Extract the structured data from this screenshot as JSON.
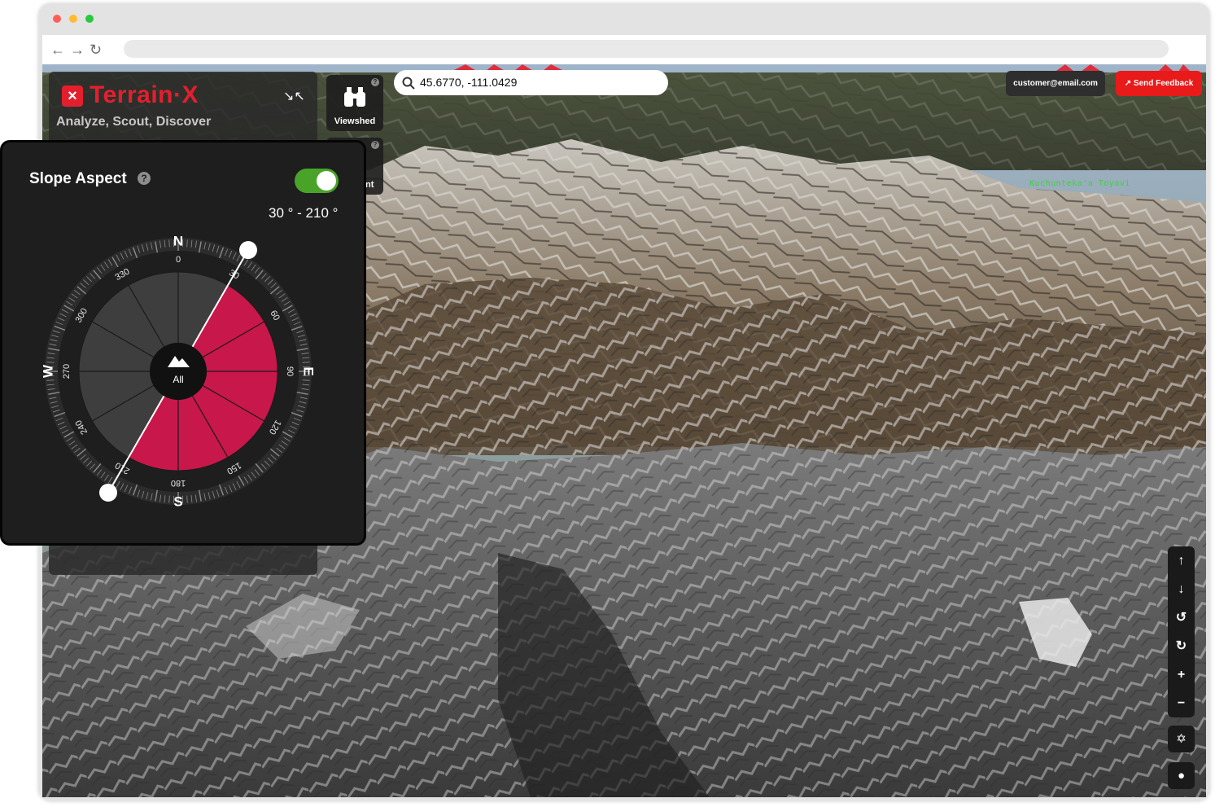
{
  "app": {
    "name": "Terrain·X",
    "tagline": "Analyze, Scout, Discover"
  },
  "browser": {
    "colors": {
      "close": "#ff5f57",
      "minimize": "#febc2e",
      "zoom": "#28c840"
    }
  },
  "tools": {
    "viewshed_label": "Viewshed",
    "second_label_fragment": "nt"
  },
  "search": {
    "value": "45.6770, -111.0429"
  },
  "header": {
    "email": "customer@email.com",
    "feedback_label": "Send Feedback"
  },
  "map": {
    "place_label": "Kuchunteka'a Toyavi"
  },
  "slope_aspect": {
    "title": "Slope Aspect",
    "enabled": true,
    "range_text": "30 ° - 210 °",
    "start_deg": 30,
    "end_deg": 210,
    "center_label": "All",
    "cardinals": {
      "n": "N",
      "e": "E",
      "s": "S",
      "w": "W"
    },
    "degree_labels": [
      "0",
      "30",
      "60",
      "90",
      "120",
      "150",
      "180",
      "210",
      "240",
      "270",
      "300",
      "330"
    ],
    "colors": {
      "selected": "#c8174a",
      "unselected": "#3e3e3e",
      "toggle_on": "#4aa329"
    }
  },
  "map_controls": {
    "icons": [
      "arrow-up-icon",
      "arrow-down-icon",
      "rotate-left-icon",
      "rotate-right-icon",
      "zoom-in-icon",
      "zoom-out-icon",
      "recenter-icon",
      "globe-icon"
    ]
  }
}
